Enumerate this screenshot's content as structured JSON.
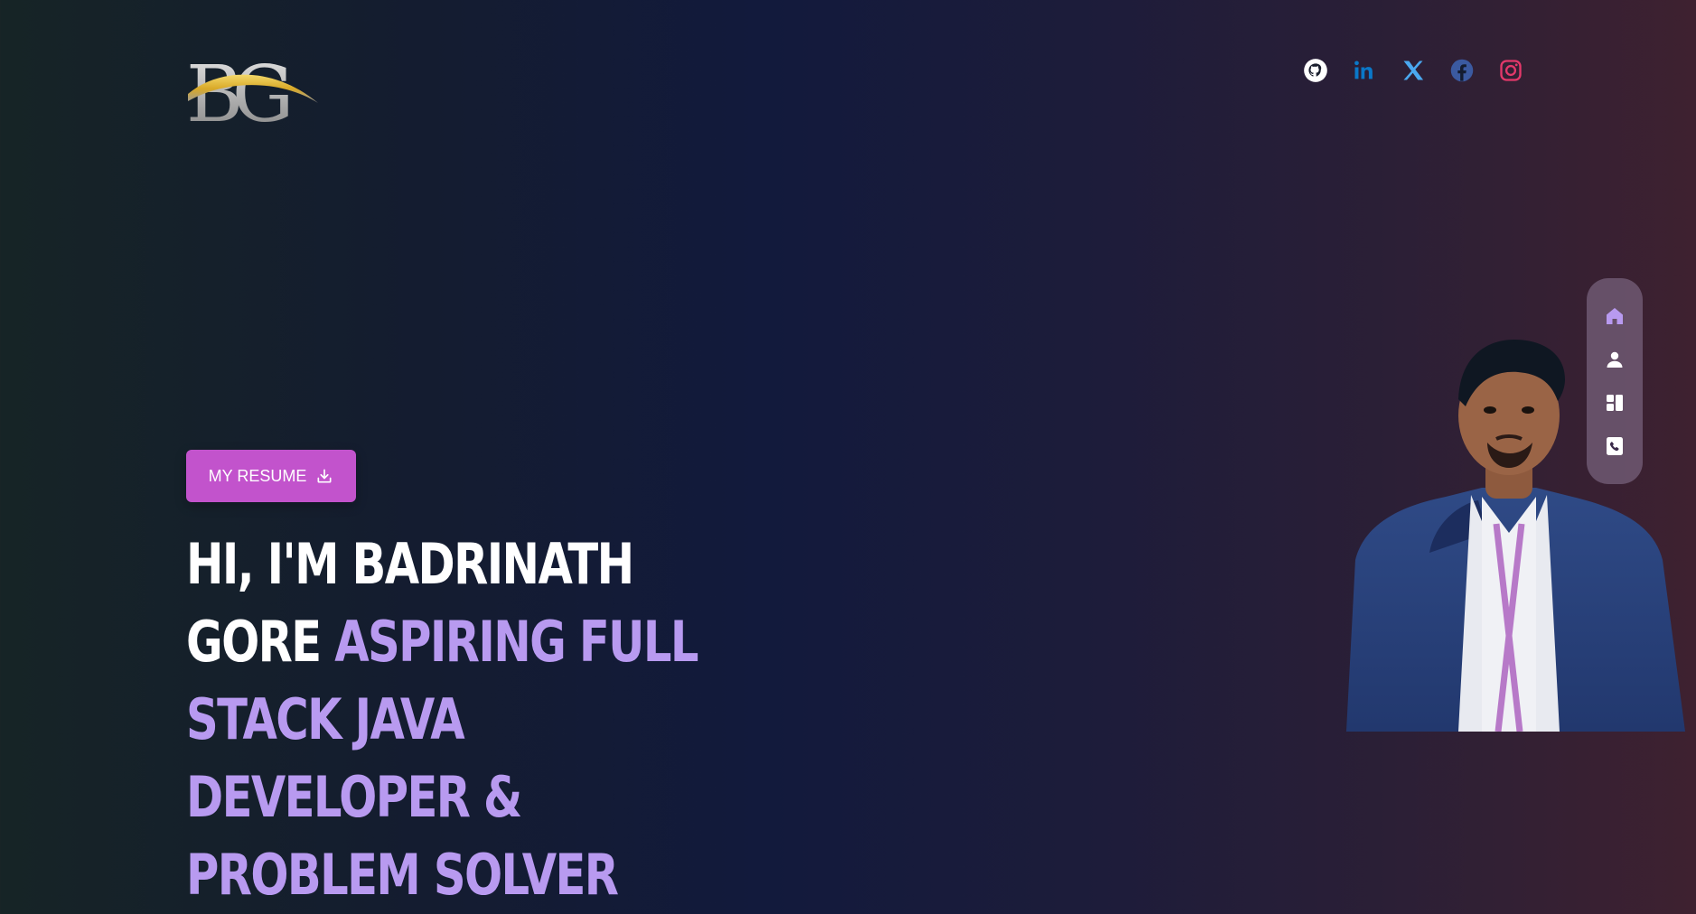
{
  "brand": {
    "logo_text": "BG",
    "logo_gold": "#e7c34a",
    "logo_silver": "#c9c9c9"
  },
  "socials": [
    {
      "name": "github-icon",
      "color": "#ffffff"
    },
    {
      "name": "linkedin-icon",
      "color": "#0a78c8"
    },
    {
      "name": "x-icon",
      "color": "#4aa8f0"
    },
    {
      "name": "facebook-icon",
      "color": "#3b5aa0"
    },
    {
      "name": "instagram-icon",
      "color": "#e4386a"
    }
  ],
  "resume": {
    "label": "MY RESUME",
    "icon": "download-icon",
    "color": "#c253cc"
  },
  "hero": {
    "intro": "HI, I'M BADRINATH GORE",
    "role": "ASPIRING FULL STACK JAVA DEVELOPER & PROBLEM SOLVER",
    "accent_color": "#b89af0"
  },
  "dock": [
    {
      "icon": "home-icon",
      "active": true
    },
    {
      "icon": "user-icon",
      "active": false
    },
    {
      "icon": "projects-icon",
      "active": false
    },
    {
      "icon": "contact-icon",
      "active": false
    }
  ]
}
